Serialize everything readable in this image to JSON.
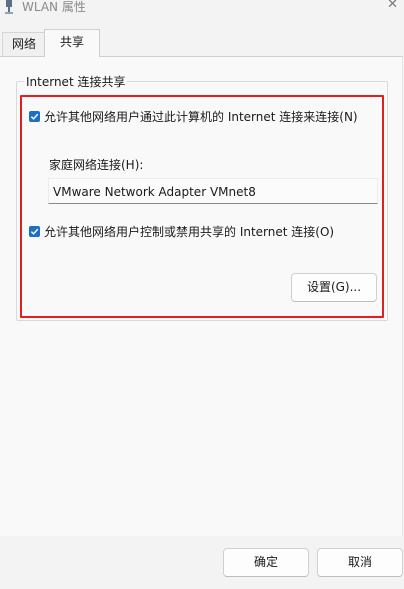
{
  "window": {
    "title": "WLAN 属性",
    "close_glyph": "✕"
  },
  "tabs": [
    {
      "label": "网络",
      "selected": false
    },
    {
      "label": "共享",
      "selected": true
    }
  ],
  "sharing": {
    "group_title": "Internet 连接共享",
    "allow_connect": {
      "label": "允许其他网络用户通过此计算机的 Internet 连接来连接(N)",
      "checked": true
    },
    "home_network_label": "家庭网络连接(H):",
    "home_network_value": "VMware Network Adapter VMnet8",
    "allow_control": {
      "label": "允许其他网络用户控制或禁用共享的 Internet 连接(O)",
      "checked": true
    },
    "settings_button": "设置(G)..."
  },
  "footer": {
    "ok_label": "确定",
    "cancel_label": "取消"
  },
  "colors": {
    "accent": "#1b6fc7",
    "highlight": "#e02020"
  }
}
